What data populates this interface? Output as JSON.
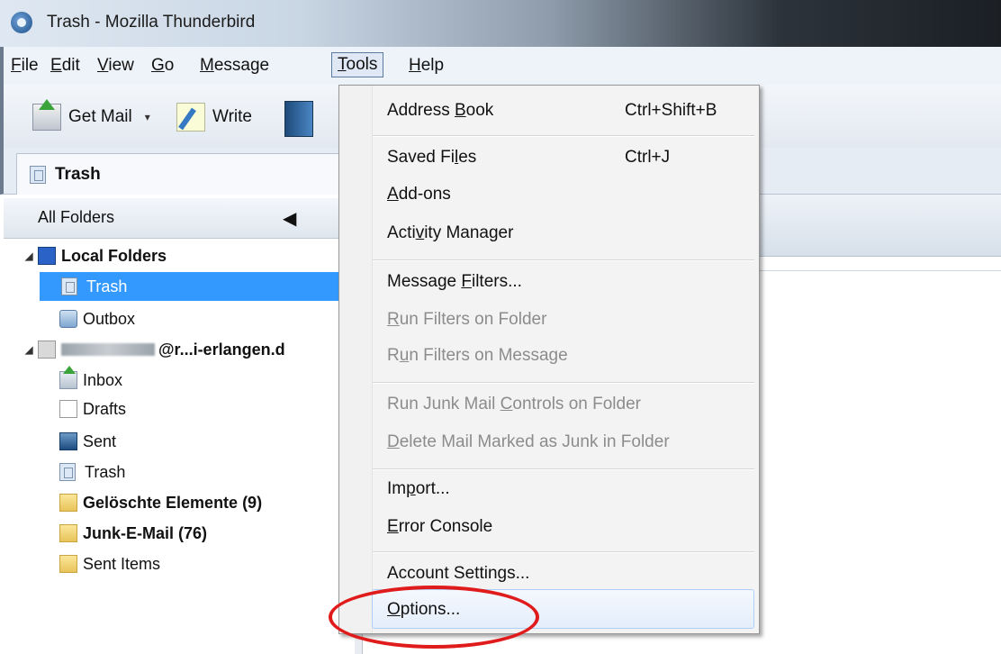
{
  "window": {
    "title": "Trash - Mozilla Thunderbird"
  },
  "menubar": {
    "items": [
      {
        "label": "File",
        "ul": "F",
        "rest": "ile"
      },
      {
        "label": "Edit",
        "ul": "E",
        "rest": "dit"
      },
      {
        "label": "View",
        "ul": "V",
        "rest": "iew"
      },
      {
        "label": "Go",
        "ul": "G",
        "rest": "o"
      },
      {
        "label": "Message",
        "ul": "M",
        "rest": "essage"
      },
      {
        "label": "Tools",
        "ul": "T",
        "rest": "ools"
      },
      {
        "label": "Help",
        "ul": "H",
        "rest": "elp"
      }
    ]
  },
  "toolbar": {
    "get_mail": "Get Mail",
    "write": "Write"
  },
  "tab": {
    "label": "Trash"
  },
  "folder_pane": {
    "header": "All Folders",
    "folders": {
      "local_folders": "Local Folders",
      "trash": "Trash",
      "outbox": "Outbox",
      "account_suffix": "@r...i-erlangen.d",
      "inbox": "Inbox",
      "drafts": "Drafts",
      "sent": "Sent",
      "trash2": "Trash",
      "geloeschte": "Gelöschte Elemente (9)",
      "junk": "Junk-E-Mail (76)",
      "sent_items": "Sent Items"
    }
  },
  "tools_menu": {
    "address_book": {
      "pre": "Address ",
      "ul": "B",
      "post": "ook",
      "shortcut": "Ctrl+Shift+B"
    },
    "saved_files": {
      "pre": "Saved Fi",
      "ul": "l",
      "post": "es",
      "shortcut": "Ctrl+J"
    },
    "add_ons": {
      "pre": "",
      "ul": "A",
      "post": "dd-ons"
    },
    "activity_manager": {
      "pre": "Acti",
      "ul": "v",
      "post": "ity Manager"
    },
    "message_filters": {
      "pre": "Message ",
      "ul": "F",
      "post": "ilters..."
    },
    "run_filters_folder": {
      "pre": "",
      "ul": "R",
      "post": "un Filters on Folder"
    },
    "run_filters_message": {
      "pre": "R",
      "ul": "u",
      "post": "n Filters on Message"
    },
    "run_junk": {
      "pre": "Run Junk Mail ",
      "ul": "C",
      "post": "ontrols on Folder"
    },
    "delete_junk": {
      "pre": "",
      "ul": "D",
      "post": "elete Mail Marked as Junk in Folder"
    },
    "import": {
      "pre": "Im",
      "ul": "p",
      "post": "ort..."
    },
    "error_console": {
      "pre": "",
      "ul": "E",
      "post": "rror Console"
    },
    "account_settings": {
      "pre": "Account Settings...",
      "ul": "",
      "post": ""
    },
    "options": {
      "pre": "",
      "ul": "O",
      "post": "ptions..."
    }
  },
  "colors": {
    "selection": "#3399ff",
    "annotation": "#e01b1b"
  }
}
